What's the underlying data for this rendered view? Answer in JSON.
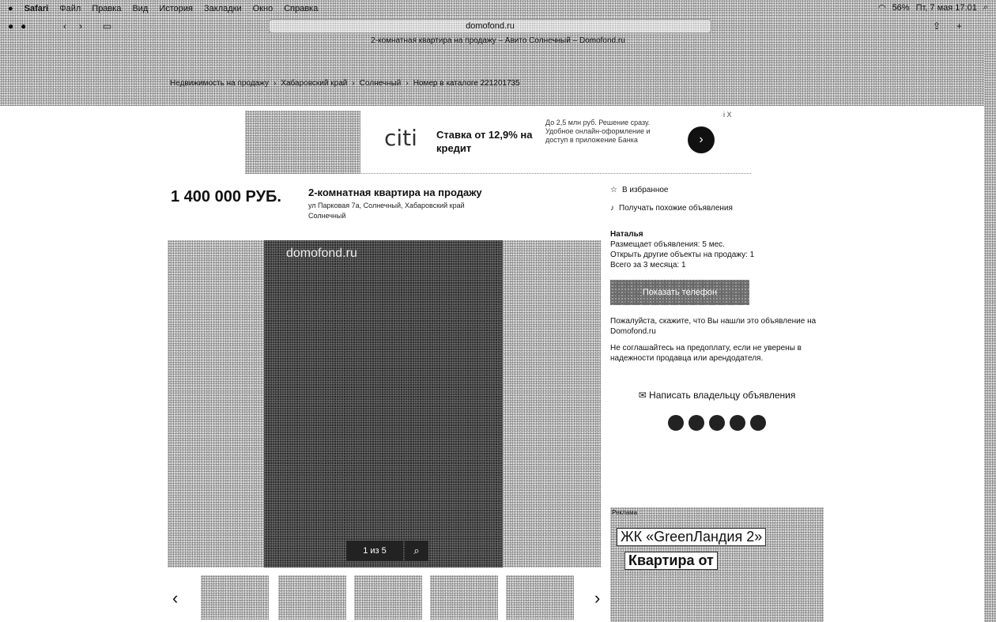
{
  "menubar": {
    "apple": "",
    "app": "Safari",
    "items": [
      "Файл",
      "Правка",
      "Вид",
      "История",
      "Закладки",
      "Окно",
      "Справка"
    ],
    "right": {
      "battery": "56%",
      "clock": "Пт, 7 мая 17:01"
    }
  },
  "browser": {
    "url": "domofond.ru",
    "tab_title": "2-комнатная квартира на продажу – Авито Солнечный – Domofond.ru"
  },
  "breadcrumb": [
    "Недвижимость на продажу",
    "Хабаровский край",
    "Солнечный",
    "Номер в каталоге 221201735"
  ],
  "ad": {
    "logo": "citi",
    "headline": "Ставка от 12,9% на кредит",
    "details": "До 2,5 млн руб. Решение сразу. Удобное онлайн-оформление и доступ в приложение Банка",
    "corner": "i X",
    "go": "›"
  },
  "listing": {
    "price": "1 400 000 РУБ.",
    "title": "2-комнатная квартира на продажу",
    "address": "ул Парковая 7а, Солнечный, Хабаровский край",
    "district": "Солнечный",
    "watermark": "domofond.ru",
    "counter": "1 из 5",
    "zoom_icon": "magnifier-icon"
  },
  "thumbs": {
    "prev": "‹",
    "next": "›"
  },
  "sidebar": {
    "favorite": "В избранное",
    "share": "Получать похожие объявления",
    "seller_name": "Наталья",
    "seller_info": [
      "Размещает объявления: 5 мес.",
      "Открыть другие объекты на продажу: 1",
      "Всего за 3 месяца: 1"
    ],
    "show_phone": "Показать телефон",
    "notice1": "Пожалуйста, скажите, что Вы нашли это объявление на Domofond.ru",
    "notice2": "Не соглашайтесь на предоплату, если не уверены в надежности продавца или арендодателя.",
    "write": "Написать владельцу объявления"
  },
  "banner": {
    "header": "Реклама",
    "line1": "ЖК «GreenЛандия 2»",
    "line2": "Квартира от"
  }
}
